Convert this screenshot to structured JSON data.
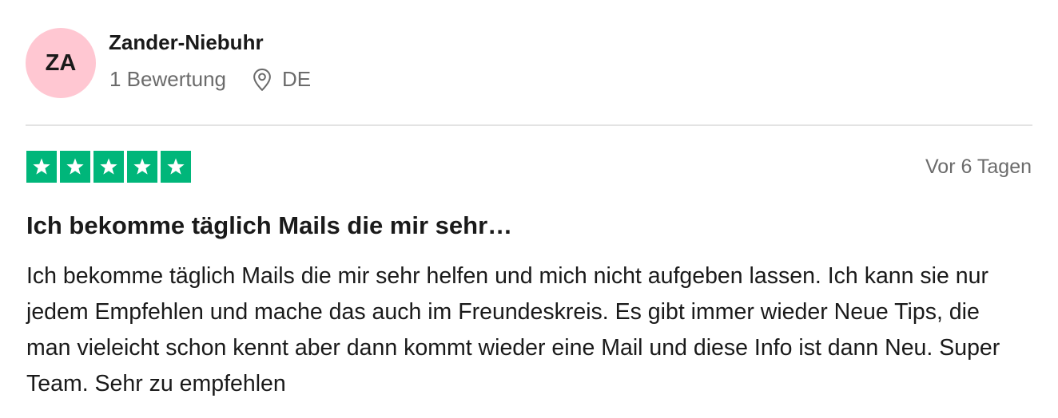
{
  "reviewer": {
    "initials": "ZA",
    "name": "Zander-Niebuhr",
    "review_count": "1 Bewertung",
    "location": "DE",
    "avatar_color": "#ffc7d2"
  },
  "review": {
    "rating": 5,
    "max_rating": 5,
    "star_color": "#00b67a",
    "date": "Vor 6 Tagen",
    "title": "Ich bekomme täglich Mails die mir sehr…",
    "body": "Ich bekomme täglich Mails die mir sehr helfen und mich nicht aufgeben lassen. Ich kann sie nur jedem Empfehlen und mache das auch im Freundeskreis. Es gibt immer wieder Neue Tips, die man vieleicht schon kennt aber dann kommt wieder eine Mail und diese Info ist dann Neu. Super Team. Sehr zu empfehlen"
  },
  "icons": {
    "location": "map-pin-icon",
    "star": "star-icon"
  }
}
